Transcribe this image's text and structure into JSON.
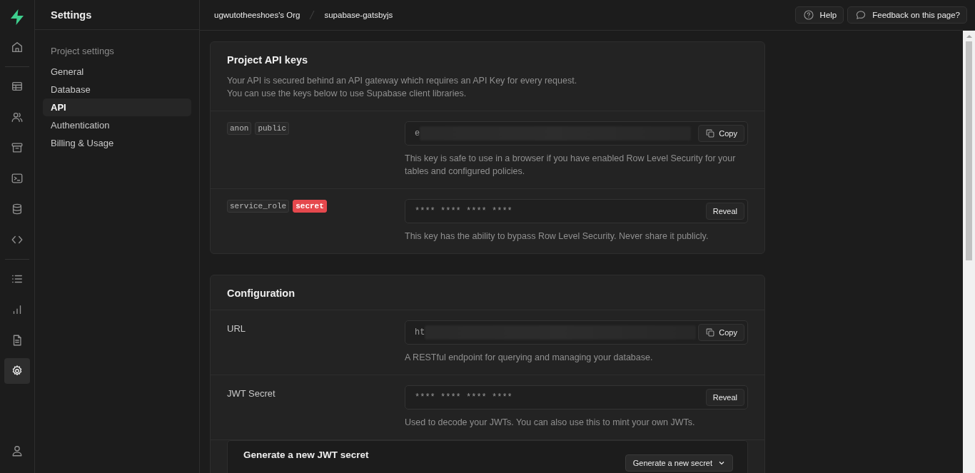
{
  "nav_rail": {
    "groups": [
      [
        {
          "selected": false
        }
      ],
      [
        {
          "selected": false
        },
        {
          "selected": false
        },
        {
          "selected": false
        },
        {
          "selected": false
        },
        {
          "selected": false
        },
        {
          "selected": false
        }
      ],
      [
        {
          "selected": false
        },
        {
          "selected": false
        },
        {
          "selected": false
        },
        {
          "selected": true
        }
      ]
    ]
  },
  "sidebar": {
    "title": "Settings",
    "section": "Project settings",
    "items": [
      {
        "label": "General",
        "selected": false
      },
      {
        "label": "Database",
        "selected": false
      },
      {
        "label": "API",
        "selected": true
      },
      {
        "label": "Authentication",
        "selected": false
      },
      {
        "label": "Billing & Usage",
        "selected": false
      }
    ]
  },
  "top_bar": {
    "breadcrumbs": [
      "ugwutotheeshoes's Org",
      "supabase-gatsbyjs"
    ],
    "buttons": [
      {
        "kind": "help",
        "label": "Help"
      },
      {
        "kind": "feedback",
        "label": "Feedback on this page?"
      }
    ]
  },
  "cards": [
    {
      "title": "Project API keys",
      "description": [
        "Your API is secured behind an API gateway which requires an API Key for every request.",
        "You can use the keys below to use Supabase client libraries."
      ],
      "rows": [
        {
          "tags": [
            {
              "text": "anon",
              "kind": "code"
            },
            {
              "text": "public",
              "kind": "code"
            }
          ],
          "field": {
            "value": "e",
            "blurred": true,
            "action": {
              "kind": "copy",
              "label": "Copy"
            }
          },
          "help": "This key is safe to use in a browser if you have enabled Row Level Security for your tables and configured policies."
        },
        {
          "tags": [
            {
              "text": "service_role",
              "kind": "code"
            },
            {
              "text": "secret",
              "kind": "danger"
            }
          ],
          "field": {
            "value": "**** **** **** ****",
            "blurred": false,
            "action": {
              "kind": "reveal",
              "label": "Reveal"
            }
          },
          "help": "This key has the ability to bypass Row Level Security. Never share it publicly."
        }
      ]
    },
    {
      "title": "Configuration",
      "rows": [
        {
          "label": "URL",
          "field": {
            "value": "ht",
            "blurred": true,
            "action": {
              "kind": "copy",
              "label": "Copy"
            }
          },
          "help": "A RESTful endpoint for querying and managing your database."
        },
        {
          "label": "JWT Secret",
          "field": {
            "value": "**** **** **** ****",
            "blurred": false,
            "action": {
              "kind": "reveal",
              "label": "Reveal"
            }
          },
          "help": "Used to decode your JWTs. You can also use this to mint your own JWTs."
        }
      ],
      "panel": {
        "title": "Generate a new JWT secret",
        "button": "Generate a new secret"
      }
    }
  ]
}
